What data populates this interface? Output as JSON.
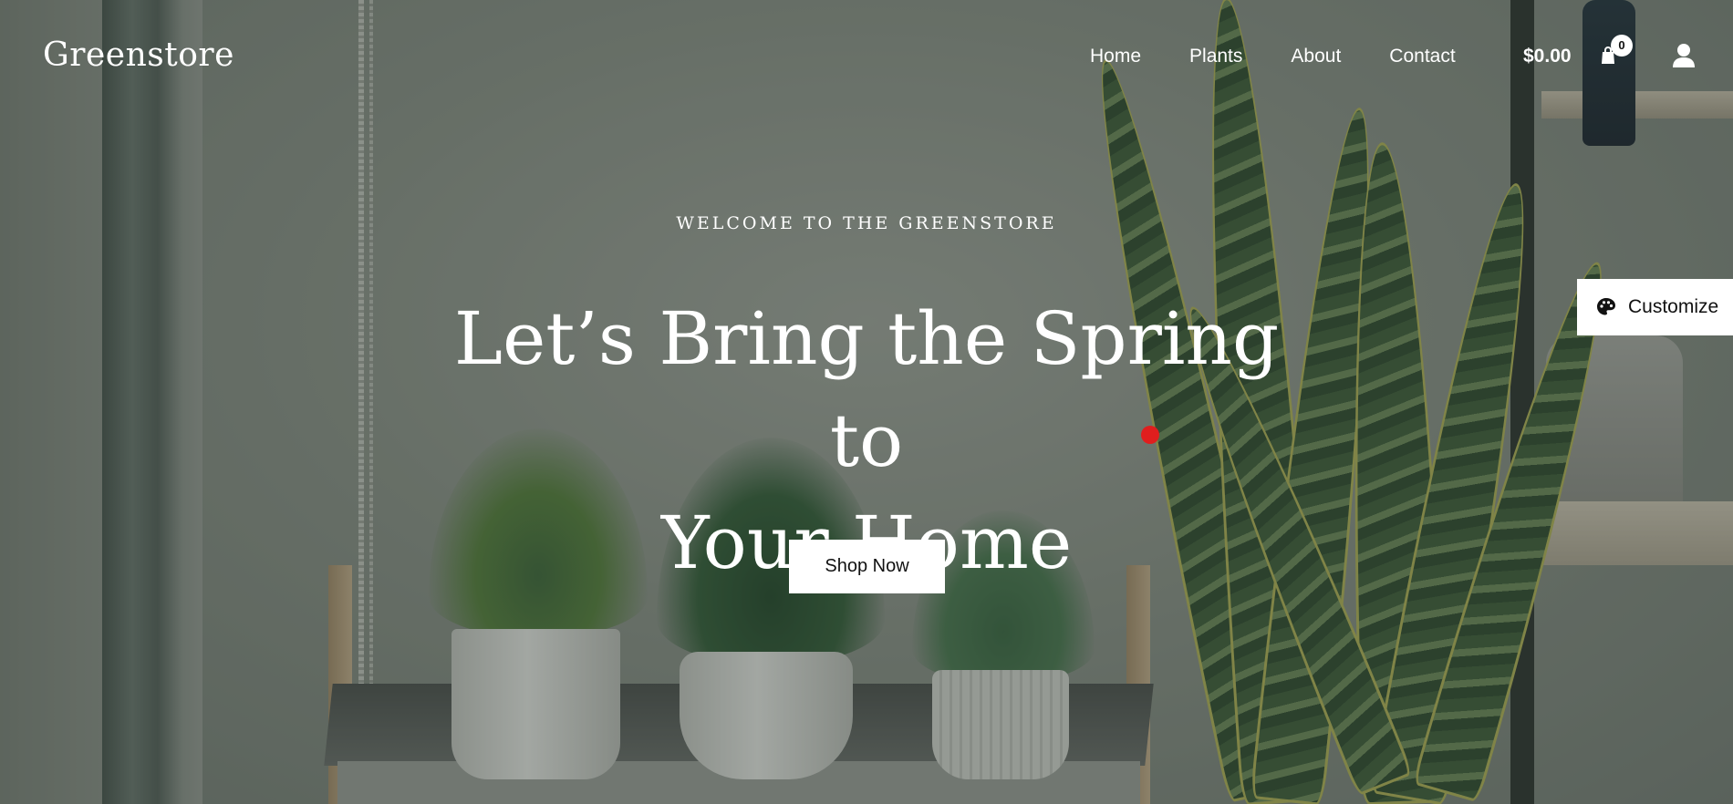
{
  "brand": {
    "name": "Greenstore"
  },
  "nav": {
    "items": [
      {
        "label": "Home"
      },
      {
        "label": "Plants"
      },
      {
        "label": "About"
      },
      {
        "label": "Contact"
      }
    ]
  },
  "cart": {
    "total": "$0.00",
    "count": "0",
    "icon": "shopping-bag-icon"
  },
  "account": {
    "icon": "user-icon"
  },
  "hero": {
    "eyebrow": "WELCOME TO THE GREENSTORE",
    "title_line1": "Let’s Bring the Spring to",
    "title_line2": "Your Home",
    "cta_label": "Shop Now"
  },
  "customize": {
    "label": "Customize",
    "icon": "palette-icon"
  },
  "colors": {
    "text": "#ffffff",
    "button_bg": "#ffffff",
    "button_text": "#111111",
    "marker": "#e01e1e"
  }
}
